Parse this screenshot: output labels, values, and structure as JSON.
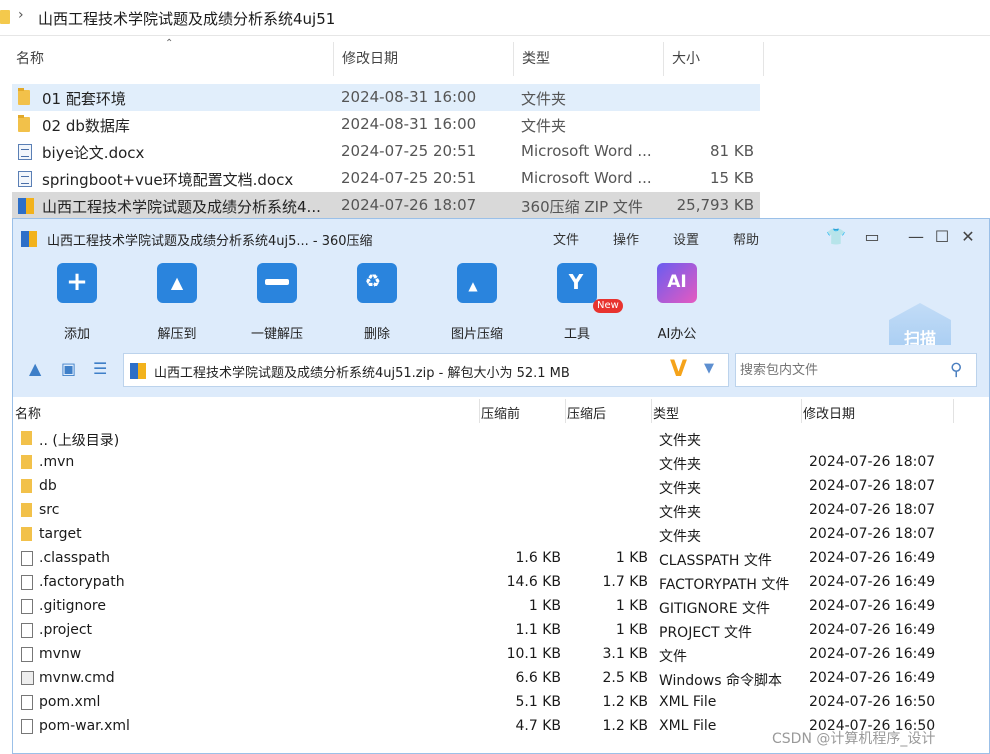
{
  "explorer": {
    "breadcrumb": "山西工程技术学院试题及成绩分析系统4uj51",
    "columns": {
      "name": "名称",
      "modified": "修改日期",
      "type": "类型",
      "size": "大小"
    },
    "rows": [
      {
        "name": "01 配套环境",
        "modified": "2024-08-31 16:00",
        "type": "文件夹",
        "size": "",
        "icon": "folder-icon"
      },
      {
        "name": "02 db数据库",
        "modified": "2024-08-31 16:00",
        "type": "文件夹",
        "size": "",
        "icon": "folder-icon"
      },
      {
        "name": "biye论文.docx",
        "modified": "2024-07-25 20:51",
        "type": "Microsoft Word ...",
        "size": "81 KB",
        "icon": "word-doc-icon"
      },
      {
        "name": "springboot+vue环境配置文档.docx",
        "modified": "2024-07-25 20:51",
        "type": "Microsoft Word ...",
        "size": "15 KB",
        "icon": "word-doc-icon"
      },
      {
        "name": "山西工程技术学院试题及成绩分析系统4...",
        "modified": "2024-07-26 18:07",
        "type": "360压缩 ZIP 文件",
        "size": "25,793 KB",
        "icon": "zip-archive-icon"
      }
    ]
  },
  "archiver": {
    "title": "山西工程技术学院试题及成绩分析系统4uj5... - 360压缩",
    "menu": [
      "文件",
      "操作",
      "设置",
      "帮助"
    ],
    "tools": [
      "添加",
      "解压到",
      "一键解压",
      "删除",
      "图片压缩",
      "工具",
      "AI办公"
    ],
    "new_badge": "New",
    "scan_label": "扫描",
    "path": "山西工程技术学院试题及成绩分析系统4uj51.zip - 解包大小为 52.1 MB",
    "search_placeholder": "搜索包内文件",
    "columns": {
      "name": "名称",
      "before": "压缩前",
      "after": "压缩后",
      "type": "类型",
      "modified": "修改日期"
    },
    "rows": [
      {
        "name": ".. (上级目录)",
        "before": "",
        "after": "",
        "type": "文件夹",
        "modified": ""
      },
      {
        "name": ".mvn",
        "before": "",
        "after": "",
        "type": "文件夹",
        "modified": "2024-07-26 18:07"
      },
      {
        "name": "db",
        "before": "",
        "after": "",
        "type": "文件夹",
        "modified": "2024-07-26 18:07"
      },
      {
        "name": "src",
        "before": "",
        "after": "",
        "type": "文件夹",
        "modified": "2024-07-26 18:07"
      },
      {
        "name": "target",
        "before": "",
        "after": "",
        "type": "文件夹",
        "modified": "2024-07-26 18:07"
      },
      {
        "name": ".classpath",
        "before": "1.6 KB",
        "after": "1 KB",
        "type": "CLASSPATH 文件",
        "modified": "2024-07-26 16:49"
      },
      {
        "name": ".factorypath",
        "before": "14.6 KB",
        "after": "1.7 KB",
        "type": "FACTORYPATH 文件",
        "modified": "2024-07-26 16:49"
      },
      {
        "name": ".gitignore",
        "before": "1 KB",
        "after": "1 KB",
        "type": "GITIGNORE 文件",
        "modified": "2024-07-26 16:49"
      },
      {
        "name": ".project",
        "before": "1.1 KB",
        "after": "1 KB",
        "type": "PROJECT 文件",
        "modified": "2024-07-26 16:49"
      },
      {
        "name": "mvnw",
        "before": "10.1 KB",
        "after": "3.1 KB",
        "type": "文件",
        "modified": "2024-07-26 16:49"
      },
      {
        "name": "mvnw.cmd",
        "before": "6.6 KB",
        "after": "2.5 KB",
        "type": "Windows 命令脚本",
        "modified": "2024-07-26 16:49"
      },
      {
        "name": "pom.xml",
        "before": "5.1 KB",
        "after": "1.2 KB",
        "type": "XML File",
        "modified": "2024-07-26 16:50"
      },
      {
        "name": "pom-war.xml",
        "before": "4.7 KB",
        "after": "1.2 KB",
        "type": "XML File",
        "modified": "2024-07-26 16:50"
      }
    ]
  },
  "watermark": "CSDN @计算机程序_设计"
}
